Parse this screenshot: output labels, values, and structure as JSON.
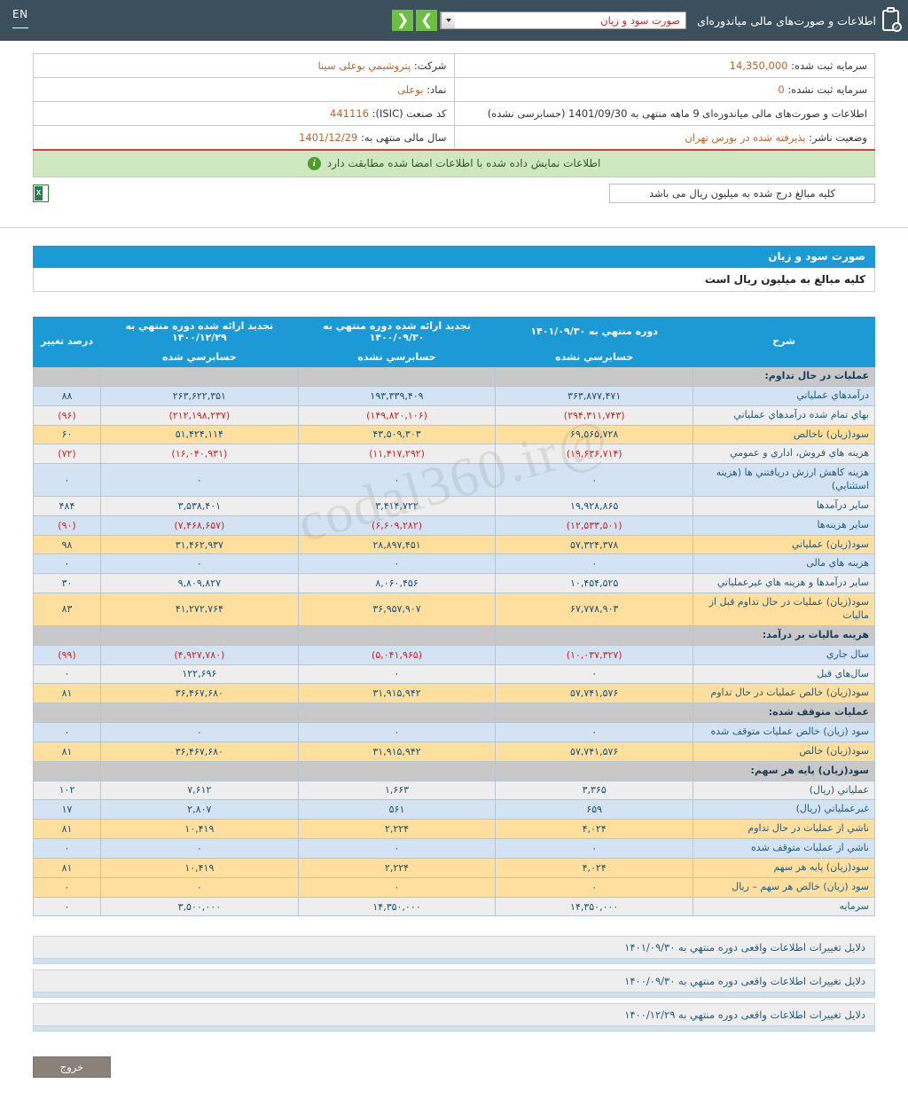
{
  "topbar": {
    "en_label": "EN",
    "title": "اطلاعات و صورت‌های مالی میاندوره‌ای",
    "selected_document": "صورت سود و زیان",
    "prev_label": "❮",
    "next_label": "❯"
  },
  "info": {
    "company_label": "شرکت:",
    "company_value": "پتروشیمي بوعلی سینا",
    "registered_capital_label": "سرمایه ثبت شده:",
    "registered_capital_value": "14,350,000",
    "symbol_label": "نماد:",
    "symbol_value": "بوعلی",
    "unregistered_capital_label": "سرمایه ثبت نشده:",
    "unregistered_capital_value": "0",
    "isic_label": "کد صنعت (ISIC):",
    "isic_value": "441116",
    "period_text": "اطلاعات و صورت‌های مالی میاندوره‌ای  9 ماهه منتهی به 1401/09/30 (حسابرسی نشده)",
    "fiscal_year_label": "سال مالی منتهی به:",
    "fiscal_year_value": "1401/12/29",
    "publisher_status_label": "وضعیت ناشر:",
    "publisher_status_value": "پذیرفته شده در بورس تهران"
  },
  "notice": {
    "text": "اطلاعات نمایش داده شده با اطلاعات امضا شده مطابقت دارد",
    "icon": "info-icon"
  },
  "subbar": {
    "rial_note": "کلیه مبالغ درج شده به میلیون ریال می باشد",
    "excel_icon": "excel-export-icon"
  },
  "section": {
    "title": "صورت سود و زیان",
    "subtitle": "کلیه مبالغ به میلیون ریال است"
  },
  "watermark": "@codal360.ir",
  "chart_data": {
    "type": "table",
    "title": "صورت سود و زیان",
    "columns": [
      {
        "key": "desc",
        "label": "شرح",
        "sub": ""
      },
      {
        "key": "c1",
        "label": "دوره منتهي به ۱۴۰۱/۰۹/۳۰",
        "sub": "حسابرسي نشده"
      },
      {
        "key": "c2",
        "label": "تجدید ارائه شده دوره منتهي به ۱۴۰۰/۰۹/۳۰",
        "sub": "حسابرسي نشده"
      },
      {
        "key": "c3",
        "label": "تجدید ارائه شده دوره منتهي به ۱۴۰۰/۱۲/۲۹",
        "sub": "حسابرسي شده"
      },
      {
        "key": "pct",
        "label": "درصد تغییر",
        "sub": ""
      }
    ],
    "rows": [
      {
        "style": "group",
        "desc": "عملیات در حال تداوم:",
        "c1": "",
        "c2": "",
        "c3": "",
        "pct": ""
      },
      {
        "style": "blue",
        "desc": "درآمدهاي عملیاتي",
        "c1": "۳۶۳,۸۷۷,۴۷۱",
        "c2": "۱۹۳,۳۳۹,۴۰۹",
        "c3": "۲۶۳,۶۲۲,۳۵۱",
        "pct": "۸۸"
      },
      {
        "style": "gray",
        "desc": "بهاي تمام شده درآمدهاي عملیاتي",
        "c1": "(۲۹۴,۳۱۱,۷۴۳)",
        "c2": "(۱۴۹,۸۲۰,۱۰۶)",
        "c3": "(۲۱۲,۱۹۸,۲۳۷)",
        "pct": "(۹۶)",
        "neg": true
      },
      {
        "style": "gold",
        "desc": "سود(زیان) ناخالص",
        "c1": "۶۹,۵۶۵,۷۲۸",
        "c2": "۴۳,۵۰۹,۳۰۳",
        "c3": "۵۱,۴۲۴,۱۱۴",
        "pct": "۶۰"
      },
      {
        "style": "gray",
        "desc": "هزینه هاي فروش، اداري و عمومي",
        "c1": "(۱۹,۶۳۶,۷۱۴)",
        "c2": "(۱۱,۴۱۷,۲۹۲)",
        "c3": "(۱۶,۰۴۰,۹۳۱)",
        "pct": "(۷۲)",
        "neg": true
      },
      {
        "style": "blue",
        "desc": "هزینه کاهش ارزش دریافتني ها (هزینه استثنایي)",
        "c1": "۰",
        "c2": "۰",
        "c3": "۰",
        "pct": "۰"
      },
      {
        "style": "gray",
        "desc": "سایر درآمدها",
        "c1": "۱۹,۹۲۸,۸۶۵",
        "c2": "۳,۴۱۴,۷۲۲",
        "c3": "۳,۵۳۸,۴۰۱",
        "pct": "۴۸۴"
      },
      {
        "style": "blue",
        "desc": "سایر هزینه‌ها",
        "c1": "(۱۲,۵۳۳,۵۰۱)",
        "c2": "(۶,۶۰۹,۲۸۲)",
        "c3": "(۷,۴۶۸,۶۵۷)",
        "pct": "(۹۰)",
        "neg": true
      },
      {
        "style": "gold",
        "desc": "سود(زیان) عملیاتي",
        "c1": "۵۷,۳۲۴,۳۷۸",
        "c2": "۲۸,۸۹۷,۴۵۱",
        "c3": "۳۱,۴۶۲,۹۳۷",
        "pct": "۹۸"
      },
      {
        "style": "blue",
        "desc": "هزینه هاي مالی",
        "c1": "۰",
        "c2": "۰",
        "c3": "۰",
        "pct": "۰"
      },
      {
        "style": "gray",
        "desc": "سایر درآمدها و هزینه هاي غیرعملیاتي",
        "c1": "۱۰,۴۵۴,۵۲۵",
        "c2": "۸,۰۶۰,۴۵۶",
        "c3": "۹,۸۰۹,۸۲۷",
        "pct": "۳۰"
      },
      {
        "style": "gold",
        "desc": "سود(زیان) عملیات در حال تداوم قبل از مالیات",
        "c1": "۶۷,۷۷۸,۹۰۳",
        "c2": "۳۶,۹۵۷,۹۰۷",
        "c3": "۴۱,۲۷۲,۷۶۴",
        "pct": "۸۳"
      },
      {
        "style": "group",
        "desc": "هزینه مالیات بر درآمد:",
        "c1": "",
        "c2": "",
        "c3": "",
        "pct": ""
      },
      {
        "style": "blue",
        "desc": "سال جاري",
        "c1": "(۱۰,۰۳۷,۳۲۷)",
        "c2": "(۵,۰۴۱,۹۶۵)",
        "c3": "(۴,۹۲۷,۷۸۰)",
        "pct": "(۹۹)",
        "neg": true
      },
      {
        "style": "gray",
        "desc": "سال‌هاي قبل",
        "c1": "۰",
        "c2": "۰",
        "c3": "۱۲۲,۶۹۶",
        "pct": "۰"
      },
      {
        "style": "gold",
        "desc": "سود(زیان) خالص عملیات در حال تداوم",
        "c1": "۵۷,۷۴۱,۵۷۶",
        "c2": "۳۱,۹۱۵,۹۴۲",
        "c3": "۳۶,۴۶۷,۶۸۰",
        "pct": "۸۱"
      },
      {
        "style": "group",
        "desc": "عملیات متوقف شده:",
        "c1": "",
        "c2": "",
        "c3": "",
        "pct": ""
      },
      {
        "style": "blue",
        "desc": "سود (زیان) خالص عملیات متوقف شده",
        "c1": "۰",
        "c2": "۰",
        "c3": "۰",
        "pct": "۰"
      },
      {
        "style": "gold",
        "desc": "سود(زیان) خالص",
        "c1": "۵۷,۷۴۱,۵۷۶",
        "c2": "۳۱,۹۱۵,۹۴۲",
        "c3": "۳۶,۴۶۷,۶۸۰",
        "pct": "۸۱"
      },
      {
        "style": "group",
        "desc": "سود(زیان) پایه هر سهم:",
        "c1": "",
        "c2": "",
        "c3": "",
        "pct": ""
      },
      {
        "style": "gray",
        "desc": "عملیاتي (ریال)",
        "c1": "۳,۳۶۵",
        "c2": "۱,۶۶۳",
        "c3": "۷,۶۱۲",
        "pct": "۱۰۲"
      },
      {
        "style": "blue",
        "desc": "غیرعملیاتي (ریال)",
        "c1": "۶۵۹",
        "c2": "۵۶۱",
        "c3": "۲,۸۰۷",
        "pct": "۱۷"
      },
      {
        "style": "gold",
        "desc": "ناشي از عملیات در حال تداوم",
        "c1": "۴,۰۲۴",
        "c2": "۲,۲۲۴",
        "c3": "۱۰,۴۱۹",
        "pct": "۸۱"
      },
      {
        "style": "blue",
        "desc": "ناشي از عملیات متوقف شده",
        "c1": "۰",
        "c2": "۰",
        "c3": "۰",
        "pct": "۰"
      },
      {
        "style": "gold",
        "desc": "سود(زیان) پایه هر سهم",
        "c1": "۴,۰۲۴",
        "c2": "۲,۲۲۴",
        "c3": "۱۰,۴۱۹",
        "pct": "۸۱"
      },
      {
        "style": "gold",
        "desc": "سود (زیان) خالص هر سهم – ریال",
        "c1": "۰",
        "c2": "۰",
        "c3": "۰",
        "pct": "۰"
      },
      {
        "style": "gray",
        "desc": "سرمایه",
        "c1": "۱۴,۳۵۰,۰۰۰",
        "c2": "۱۴,۳۵۰,۰۰۰",
        "c3": "۳,۵۰۰,۰۰۰",
        "pct": "۰"
      }
    ]
  },
  "footer": {
    "links": [
      "دلایل تغییرات اطلاعات واقعی دوره منتهي به ۱۴۰۱/۰۹/۳۰",
      "دلایل تغییرات اطلاعات واقعی دوره منتهي به ۱۴۰۰/۰۹/۳۰",
      "دلایل تغییرات اطلاعات واقعی دوره منتهي به ۱۴۰۰/۱۲/۲۹"
    ],
    "exit_label": "خروج"
  }
}
